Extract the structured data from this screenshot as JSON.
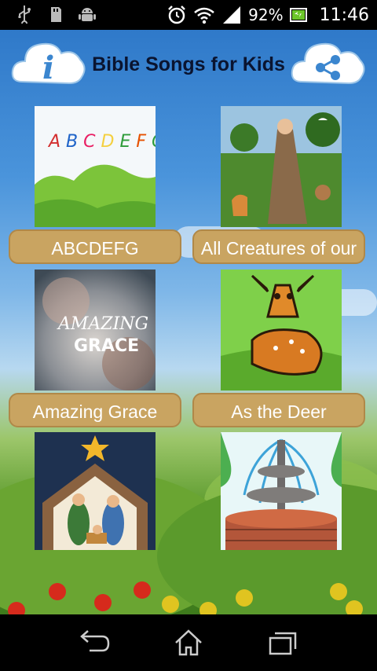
{
  "status_bar": {
    "battery": "92%",
    "time": "11:46",
    "left_icons": [
      "usb-icon",
      "sd-card-icon",
      "android-debug-icon"
    ],
    "right_icons": [
      "alarm-icon",
      "wifi-icon",
      "signal-icon",
      "battery-icon"
    ]
  },
  "header": {
    "title": "Bible Songs for Kids",
    "info_button_glyph": "i",
    "share_button_icon": "share-icon"
  },
  "songs": [
    {
      "label": "ABCDEFG",
      "thumb_text": "A B C D E F G"
    },
    {
      "label": "All Creatures of our"
    },
    {
      "label": "Amazing Grace",
      "thumb_text_top": "AMAZING",
      "thumb_text_bottom": "GRACE"
    },
    {
      "label": "As the Deer"
    },
    {
      "label": ""
    },
    {
      "label": ""
    }
  ],
  "nav_bar": {
    "icons": [
      "back-icon",
      "home-icon",
      "recent-apps-icon"
    ]
  },
  "colors": {
    "label_bg": "#c9a461",
    "title_text": "#0a1430",
    "sky": "#3a85d2"
  }
}
